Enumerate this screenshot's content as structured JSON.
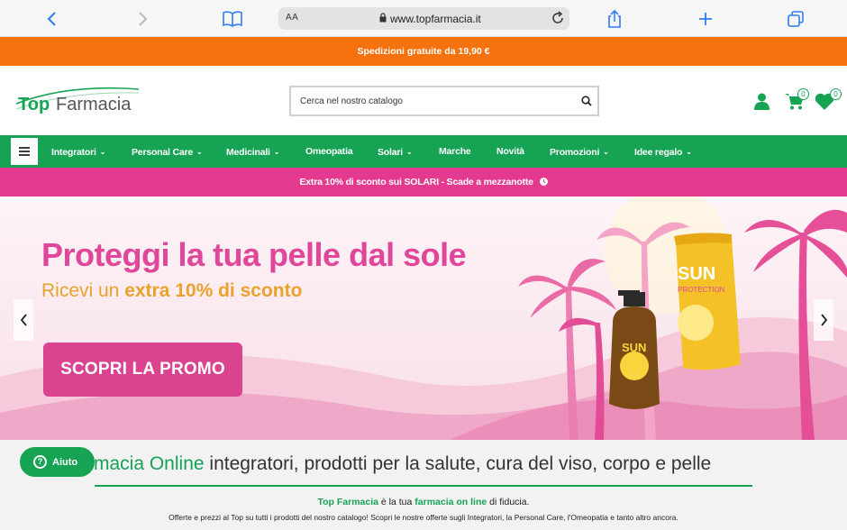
{
  "browser": {
    "aa_label": "AA",
    "url": "www.topfarmacia.it"
  },
  "shipping_bar": {
    "text": "Spedizioni gratuite da 19,90 €"
  },
  "header": {
    "logo_word1": "Top",
    "logo_word2": "Farmacia",
    "search_placeholder": "Cerca nel nostro catalogo",
    "cart_count": "0",
    "wishlist_count": "0"
  },
  "nav": {
    "items": [
      {
        "label": "Integratori",
        "has_dropdown": true
      },
      {
        "label": "Personal Care",
        "has_dropdown": true
      },
      {
        "label": "Medicinali",
        "has_dropdown": true
      },
      {
        "label": "Omeopatia",
        "has_dropdown": false
      },
      {
        "label": "Solari",
        "has_dropdown": true
      },
      {
        "label": "Marche",
        "has_dropdown": false
      },
      {
        "label": "Novità",
        "has_dropdown": false
      },
      {
        "label": "Promozioni",
        "has_dropdown": true
      },
      {
        "label": "Idee regalo",
        "has_dropdown": true
      }
    ]
  },
  "promo_bar": {
    "text": "Extra 10% di sconto sui SOLARI - Scade a mezzanotte"
  },
  "hero": {
    "title": "Proteggi la tua pelle dal sole",
    "subtitle_prefix": "Ricevi un ",
    "subtitle_bold": "extra 10% di sconto",
    "button_label": "SCOPRI LA PROMO",
    "bottle_label": "SUN",
    "tube_label_1": "SUN",
    "tube_label_2": "PROTECTION"
  },
  "intro": {
    "title_green": "macia Online",
    "title_rest": " integratori, prodotti per la salute, cura del viso, corpo e pelle",
    "p1_brand": "Top Farmacia",
    "p1_mid": " è la tua ",
    "p1_link": "farmacia on line",
    "p1_end": " di fiducia.",
    "p2": "Offerte e prezzi al Top su tutti i prodotti del nostro catalogo! Scopri le nostre offerte sugli Integratori, la Personal Care, l'Omeopatia e tanto altro ancora."
  },
  "help_button": {
    "label": "Aiuto"
  },
  "colors": {
    "orange": "#f5720e",
    "green": "#16a354",
    "pink": "#e33a8f",
    "hero_pink": "#e0469a",
    "hero_yellow": "#e9a22a"
  }
}
